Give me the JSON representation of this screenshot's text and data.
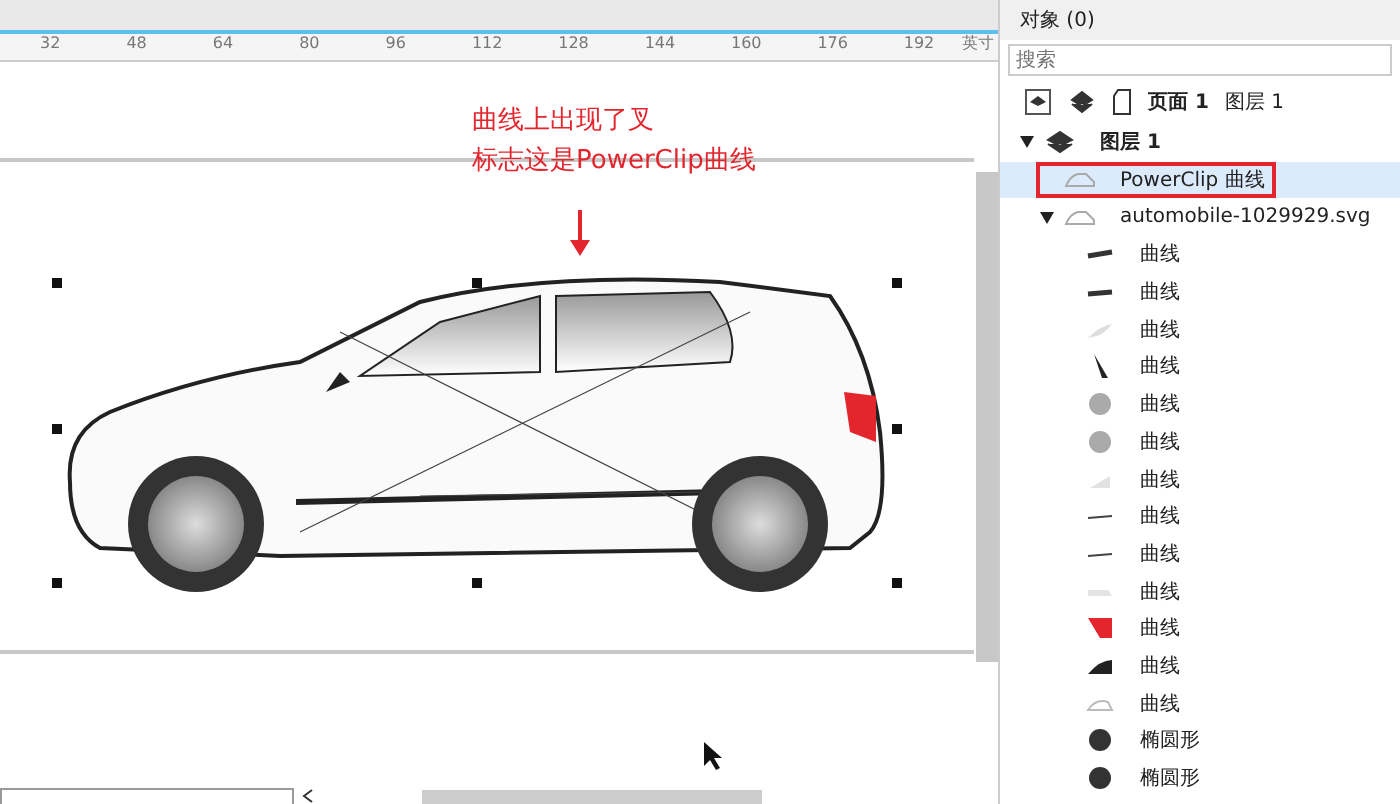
{
  "ruler": {
    "ticks": [
      "32",
      "48",
      "64",
      "80",
      "96",
      "112",
      "128",
      "144",
      "160",
      "176",
      "192"
    ],
    "unit": "英寸"
  },
  "annotation": {
    "lines": [
      "曲线上出现了叉",
      "标志这是PowerClip曲线"
    ]
  },
  "objects_panel": {
    "title": "对象 (0)",
    "search": {
      "placeholder": "搜索"
    },
    "page_label": "页面 1",
    "layer_label": "图层 1",
    "tree": [
      {
        "label": "图层 1",
        "expanded": true,
        "selected": false,
        "children": [
          {
            "label": "PowerClip 曲线",
            "selected": true,
            "highlighted": true
          },
          {
            "label": "automobile-1029929.svg",
            "selected": false,
            "expanded": true,
            "children": [
              {
                "label": "曲线",
                "selected": false
              },
              {
                "label": "曲线",
                "selected": false
              },
              {
                "label": "曲线",
                "selected": false
              },
              {
                "label": "曲线",
                "selected": false
              },
              {
                "label": "曲线",
                "selected": false
              },
              {
                "label": "曲线",
                "selected": false
              },
              {
                "label": "曲线",
                "selected": false
              },
              {
                "label": "曲线",
                "selected": false
              },
              {
                "label": "曲线",
                "selected": false
              },
              {
                "label": "曲线",
                "selected": false
              },
              {
                "label": "曲线",
                "selected": false
              },
              {
                "label": "曲线",
                "selected": false
              },
              {
                "label": "曲线",
                "selected": false
              },
              {
                "label": "椭圆形",
                "selected": false
              },
              {
                "label": "椭圆形",
                "selected": false
              }
            ]
          }
        ]
      }
    ]
  }
}
